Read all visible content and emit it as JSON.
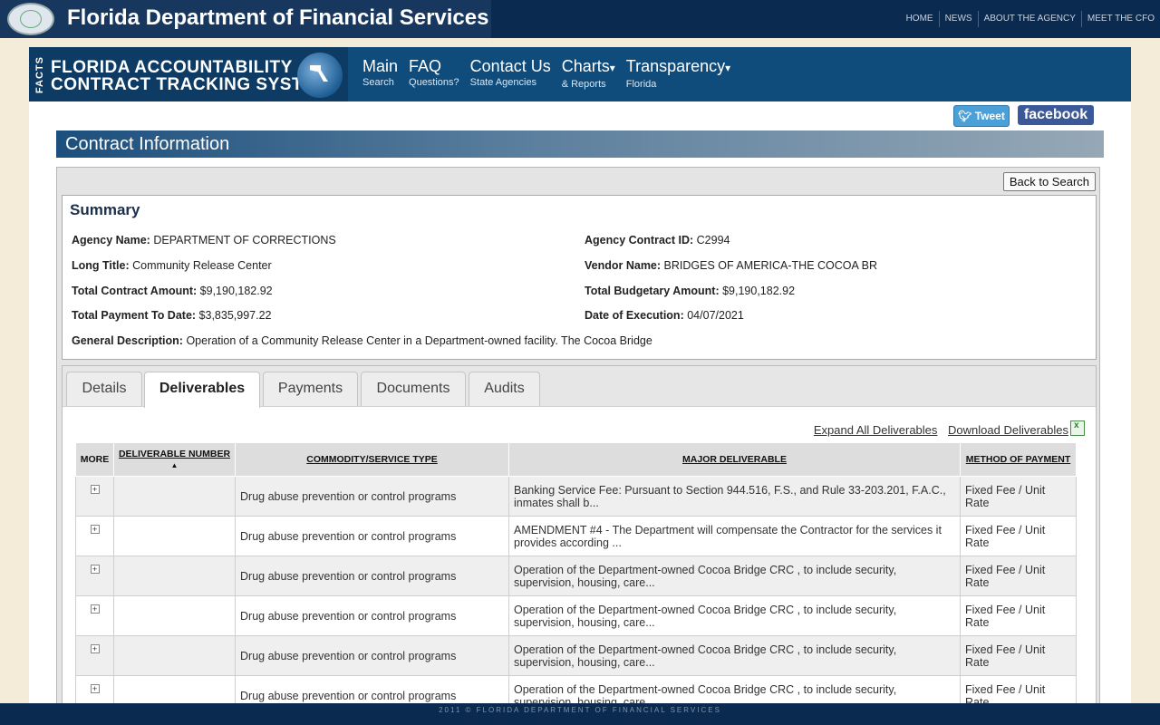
{
  "header": {
    "title": "Florida Department of Financial Services",
    "nav": [
      "HOME",
      "NEWS",
      "ABOUT THE AGENCY",
      "MEET THE CFO"
    ]
  },
  "facts": {
    "vertical": "FACTS",
    "line1": "FLORIDA  ACCOUNTABILITY",
    "line2": "CONTRACT TRACKING SYSTEM"
  },
  "main_nav": [
    {
      "main": "Main",
      "sub": "Search"
    },
    {
      "main": "FAQ",
      "sub": "Questions?"
    },
    {
      "main": "Contact Us",
      "sub": "State Agencies"
    },
    {
      "main": "Charts",
      "sub": "& Reports",
      "caret": "▾"
    },
    {
      "main": "Transparency",
      "sub": "Florida",
      "caret": "▾"
    }
  ],
  "social": {
    "tweet": "Tweet",
    "facebook": "facebook"
  },
  "section_title": "Contract Information",
  "back_label": "Back to Search",
  "summary": {
    "title": "Summary",
    "agency_name_label": "Agency Name:",
    "agency_name": "DEPARTMENT OF CORRECTIONS",
    "contract_id_label": "Agency Contract ID:",
    "contract_id": "C2994",
    "long_title_label": "Long Title:",
    "long_title": "Community Release Center",
    "vendor_label": "Vendor Name:",
    "vendor": "BRIDGES OF AMERICA-THE COCOA BR",
    "total_amount_label": "Total Contract Amount:",
    "total_amount": "$9,190,182.92",
    "budgetary_label": "Total Budgetary Amount:",
    "budgetary": "$9,190,182.92",
    "payment_label": "Total Payment To Date:",
    "payment": "$3,835,997.22",
    "execution_label": "Date of Execution:",
    "execution": "04/07/2021",
    "description_label": "General Description:",
    "description": "Operation of a Community Release Center in a Department-owned facility. The Cocoa Bridge"
  },
  "tabs": [
    "Details",
    "Deliverables",
    "Payments",
    "Documents",
    "Audits"
  ],
  "links": {
    "expand": "Expand All Deliverables",
    "download": "Download Deliverables"
  },
  "table": {
    "headers": [
      "MORE",
      "DELIVERABLE NUMBER",
      "COMMODITY/SERVICE TYPE",
      "MAJOR DELIVERABLE",
      "METHOD OF PAYMENT"
    ],
    "sort_indicator": "▲",
    "rows": [
      {
        "number": "",
        "type": "Drug abuse prevention or control programs",
        "deliverable": "Banking Service Fee: Pursuant to Section 944.516, F.S., and Rule 33-203.201, F.A.C., inmates shall b...",
        "method": "Fixed Fee / Unit Rate"
      },
      {
        "number": "",
        "type": "Drug abuse prevention or control programs",
        "deliverable": "AMENDMENT #4 - The Department will compensate the Contractor for the services it provides according ...",
        "method": "Fixed Fee / Unit Rate"
      },
      {
        "number": "",
        "type": "Drug abuse prevention or control programs",
        "deliverable": "Operation of the Department-owned Cocoa Bridge CRC , to include security, supervision, housing, care...",
        "method": "Fixed Fee / Unit Rate"
      },
      {
        "number": "",
        "type": "Drug abuse prevention or control programs",
        "deliverable": "Operation of the Department-owned Cocoa Bridge CRC , to include security, supervision, housing, care...",
        "method": "Fixed Fee / Unit Rate"
      },
      {
        "number": "",
        "type": "Drug abuse prevention or control programs",
        "deliverable": "Operation of the Department-owned Cocoa Bridge CRC , to include security, supervision, housing, care...",
        "method": "Fixed Fee / Unit Rate"
      },
      {
        "number": "",
        "type": "Drug abuse prevention or control programs",
        "deliverable": "Operation of the Department-owned Cocoa Bridge CRC , to include security, supervision, housing, care...",
        "method": "Fixed Fee / Unit Rate"
      }
    ],
    "expand_glyph": "+"
  },
  "footer": "2011 © FLORIDA DEPARTMENT OF FINANCIAL SERVICES"
}
